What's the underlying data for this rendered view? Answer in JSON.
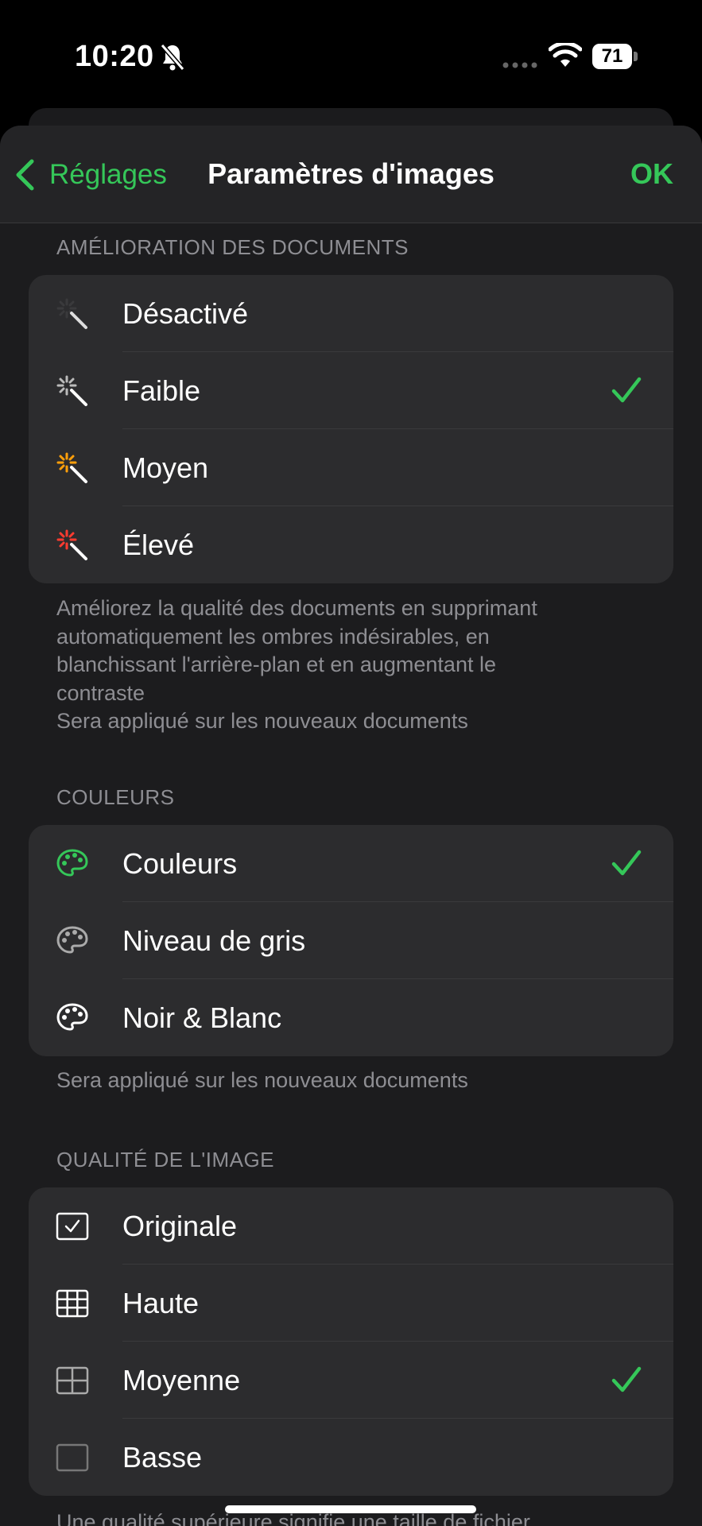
{
  "status_bar": {
    "time": "10:20",
    "battery": "71"
  },
  "nav": {
    "back_label": "Réglages",
    "title": "Paramètres d'images",
    "done_label": "OK"
  },
  "enhancement": {
    "header": "AMÉLIORATION DES DOCUMENTS",
    "items": [
      {
        "label": "Désactivé",
        "icon": "magic-wand-off-icon",
        "selected": false
      },
      {
        "label": "Faible",
        "icon": "magic-wand-low-icon",
        "selected": true
      },
      {
        "label": "Moyen",
        "icon": "magic-wand-medium-icon",
        "selected": false
      },
      {
        "label": "Élevé",
        "icon": "magic-wand-high-icon",
        "selected": false
      }
    ],
    "footer_lines": [
      "Améliorez la qualité des documents en supprimant",
      "automatiquement les ombres indésirables, en",
      "blanchissant l'arrière-plan et en augmentant le",
      "contraste",
      "Sera appliqué sur les nouveaux documents"
    ]
  },
  "colors": {
    "header": "COULEURS",
    "items": [
      {
        "label": "Couleurs",
        "icon": "palette-color-icon",
        "selected": true
      },
      {
        "label": "Niveau de gris",
        "icon": "palette-gray-icon",
        "selected": false
      },
      {
        "label": "Noir & Blanc",
        "icon": "palette-bw-icon",
        "selected": false
      }
    ],
    "footer": "Sera appliqué sur les nouveaux documents"
  },
  "quality": {
    "header": "QUALITÉ DE L'IMAGE",
    "items": [
      {
        "label": "Originale",
        "icon": "checkbox-square-icon",
        "selected": false
      },
      {
        "label": "Haute",
        "icon": "grid-fine-icon",
        "selected": false
      },
      {
        "label": "Moyenne",
        "icon": "grid-medium-icon",
        "selected": true
      },
      {
        "label": "Basse",
        "icon": "empty-square-icon",
        "selected": false
      }
    ],
    "footer": "Une qualité supérieure signifie une taille de fichier"
  },
  "theme": {
    "accent": "#35c759",
    "background": "#1c1c1e",
    "cell": "#2c2c2e",
    "secondary_text": "#8e8e93"
  }
}
